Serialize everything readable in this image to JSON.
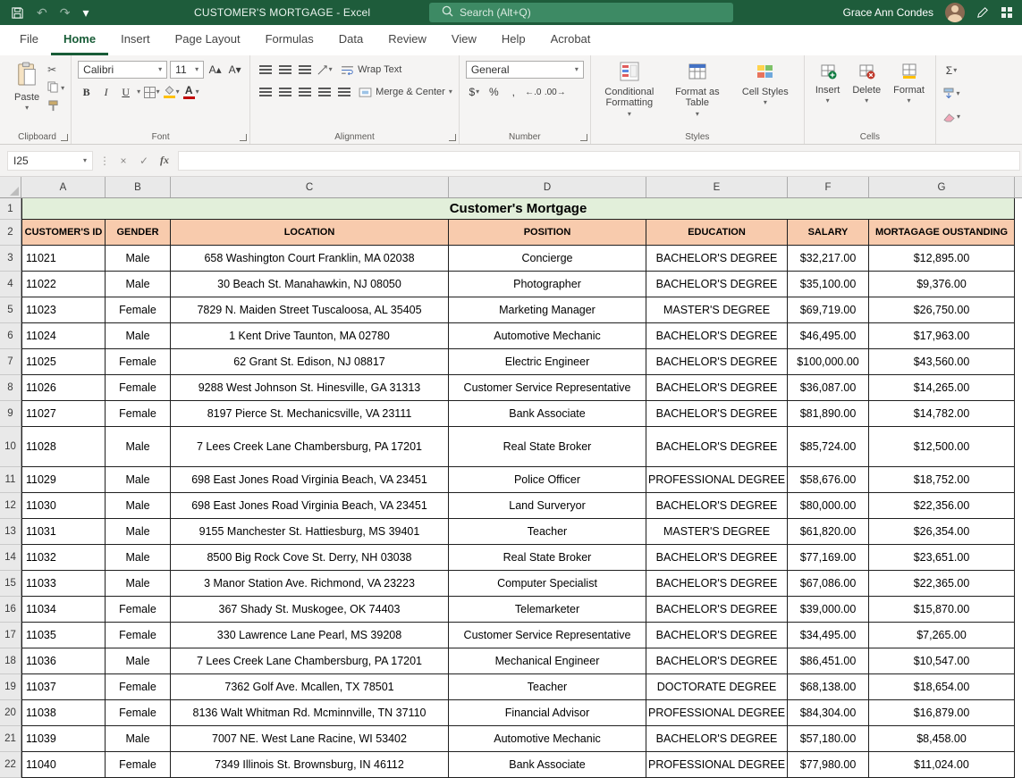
{
  "title_bar": {
    "document_title": "CUSTOMER'S MORTGAGE - Excel",
    "search_placeholder": "Search (Alt+Q)",
    "user_name": "Grace Ann Condes"
  },
  "menu": {
    "tabs": [
      "File",
      "Home",
      "Insert",
      "Page Layout",
      "Formulas",
      "Data",
      "Review",
      "View",
      "Help",
      "Acrobat"
    ],
    "active_tab": "Home"
  },
  "ribbon": {
    "clipboard": {
      "label": "Clipboard",
      "paste": "Paste"
    },
    "font": {
      "label": "Font",
      "font_name": "Calibri",
      "font_size": "11"
    },
    "alignment": {
      "label": "Alignment",
      "wrap_text": "Wrap Text",
      "merge_center": "Merge & Center"
    },
    "number": {
      "label": "Number",
      "format": "General"
    },
    "styles": {
      "label": "Styles",
      "conditional_formatting": "Conditional Formatting",
      "format_as_table": "Format as Table",
      "cell_styles": "Cell Styles"
    },
    "cells": {
      "label": "Cells",
      "insert": "Insert",
      "delete": "Delete",
      "format": "Format"
    }
  },
  "formula_bar": {
    "cell_reference": "I25",
    "fx": "fx"
  },
  "icons": {
    "undo": "↶",
    "redo": "↷",
    "dropdown": "▾",
    "scissors": "✂",
    "sigma": "Σ",
    "bold": "B",
    "italic": "I",
    "underline": "U",
    "font_increase": "A▴",
    "font_decrease": "A▾",
    "dollar": "$",
    "percent": "%",
    "comma": ",",
    "increase_decimal": "←.0",
    "decrease_decimal": ".00→",
    "cancel": "×",
    "enter": "✓",
    "divider_dots": "⋮"
  },
  "sheet": {
    "title": "Customer's Mortgage",
    "column_letters": [
      "A",
      "B",
      "C",
      "D",
      "E",
      "F",
      "G"
    ],
    "header_row": [
      "CUSTOMER'S ID",
      "GENDER",
      "LOCATION",
      "POSITION",
      "EDUCATION",
      "SALARY",
      "MORTAGAGE OUSTANDING"
    ],
    "rows": [
      [
        "11021",
        "Male",
        "658 Washington Court Franklin, MA 02038",
        "Concierge",
        "BACHELOR'S DEGREE",
        "$32,217.00",
        "$12,895.00"
      ],
      [
        "11022",
        "Male",
        "30 Beach St. Manahawkin, NJ 08050",
        "Photographer",
        "BACHELOR'S DEGREE",
        "$35,100.00",
        "$9,376.00"
      ],
      [
        "11023",
        "Female",
        "7829 N. Maiden Street Tuscaloosa, AL 35405",
        "Marketing Manager",
        "MASTER'S DEGREE",
        "$69,719.00",
        "$26,750.00"
      ],
      [
        "11024",
        "Male",
        "1 Kent Drive Taunton, MA 02780",
        "Automotive Mechanic",
        "BACHELOR'S DEGREE",
        "$46,495.00",
        "$17,963.00"
      ],
      [
        "11025",
        "Female",
        "62 Grant St. Edison, NJ 08817",
        "Electric Engineer",
        "BACHELOR'S DEGREE",
        "$100,000.00",
        "$43,560.00"
      ],
      [
        "11026",
        "Female",
        "9288 West Johnson St. Hinesville, GA 31313",
        "Customer Service Representative",
        "BACHELOR'S DEGREE",
        "$36,087.00",
        "$14,265.00"
      ],
      [
        "11027",
        "Female",
        "8197 Pierce St. Mechanicsville, VA 23111",
        "Bank Associate",
        "BACHELOR'S DEGREE",
        "$81,890.00",
        "$14,782.00"
      ],
      [
        "11028",
        "Male",
        "7 Lees Creek Lane Chambersburg, PA 17201",
        "Real State Broker",
        "BACHELOR'S DEGREE",
        "$85,724.00",
        "$12,500.00"
      ],
      [
        "11029",
        "Male",
        "698 East Jones Road Virginia Beach, VA 23451",
        "Police Officer",
        "PROFESSIONAL DEGREE",
        "$58,676.00",
        "$18,752.00"
      ],
      [
        "11030",
        "Male",
        "698 East Jones Road Virginia Beach, VA 23451",
        "Land Surveryor",
        "BACHELOR'S DEGREE",
        "$80,000.00",
        "$22,356.00"
      ],
      [
        "11031",
        "Male",
        "9155 Manchester St. Hattiesburg, MS 39401",
        "Teacher",
        "MASTER'S DEGREE",
        "$61,820.00",
        "$26,354.00"
      ],
      [
        "11032",
        "Male",
        "8500 Big Rock Cove St. Derry, NH 03038",
        "Real State Broker",
        "BACHELOR'S DEGREE",
        "$77,169.00",
        "$23,651.00"
      ],
      [
        "11033",
        "Male",
        "3 Manor Station Ave. Richmond, VA 23223",
        "Computer Specialist",
        "BACHELOR'S DEGREE",
        "$67,086.00",
        "$22,365.00"
      ],
      [
        "11034",
        "Female",
        "367 Shady St. Muskogee, OK 74403",
        "Telemarketer",
        "BACHELOR'S DEGREE",
        "$39,000.00",
        "$15,870.00"
      ],
      [
        "11035",
        "Female",
        "330 Lawrence Lane Pearl, MS 39208",
        "Customer Service Representative",
        "BACHELOR'S DEGREE",
        "$34,495.00",
        "$7,265.00"
      ],
      [
        "11036",
        "Male",
        "7 Lees Creek Lane Chambersburg, PA 17201",
        "Mechanical Engineer",
        "BACHELOR'S DEGREE",
        "$86,451.00",
        "$10,547.00"
      ],
      [
        "11037",
        "Female",
        "7362 Golf Ave. Mcallen, TX 78501",
        "Teacher",
        "DOCTORATE DEGREE",
        "$68,138.00",
        "$18,654.00"
      ],
      [
        "11038",
        "Female",
        "8136 Walt Whitman Rd. Mcminnville, TN 37110",
        "Financial Advisor",
        "PROFESSIONAL DEGREE",
        "$84,304.00",
        "$16,879.00"
      ],
      [
        "11039",
        "Male",
        "7007 NE. West Lane Racine, WI 53402",
        "Automotive Mechanic",
        "BACHELOR'S DEGREE",
        "$57,180.00",
        "$8,458.00"
      ],
      [
        "11040",
        "Female",
        "7349 Illinois St. Brownsburg, IN 46112",
        "Bank Associate",
        "PROFESSIONAL DEGREE",
        "$77,980.00",
        "$11,024.00"
      ]
    ]
  }
}
